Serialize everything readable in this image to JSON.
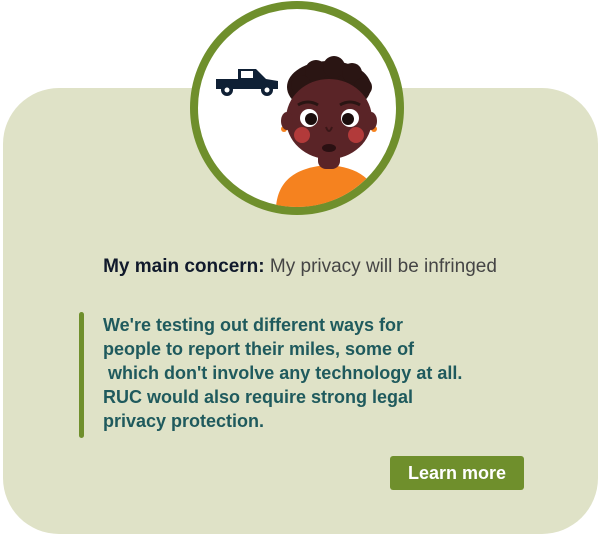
{
  "concern": {
    "label": "My main concern:",
    "value": "My privacy will be infringed"
  },
  "message": {
    "lines": [
      "We're testing out different ways for",
      "people to report their miles, some of",
      " which don't involve any technology at all.",
      "RUC would also require strong legal",
      "privacy protection."
    ]
  },
  "cta": {
    "label": "Learn more"
  },
  "icons": {
    "vehicle": "pickup-truck-icon",
    "portrait": "person-avatar"
  },
  "colors": {
    "card_background": "#dfe2c7",
    "accent_green": "#6f8f2c",
    "quote_text": "#1f5a5d",
    "heading_text": "#111a2c",
    "shirt_orange": "#f5821f"
  }
}
